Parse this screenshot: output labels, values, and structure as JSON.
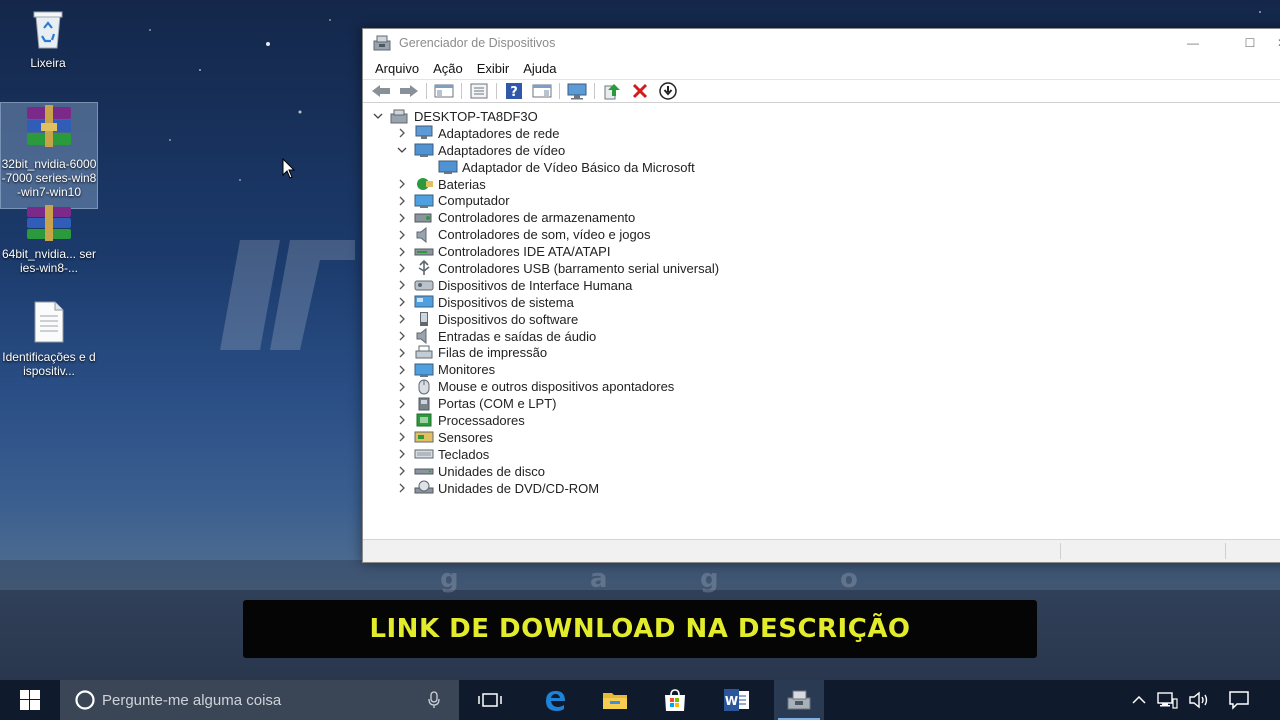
{
  "desktop": {
    "icons": [
      {
        "label": "Lixeira",
        "icon": "recycle-bin-icon"
      },
      {
        "label": "32bit_nvidia-6000-7000 series-win8-win7-win10",
        "icon": "winrar-archive-icon"
      },
      {
        "label": "64bit_nvidia... series-win8-...",
        "icon": "winrar-archive-icon"
      },
      {
        "label": "Identificações e dispositiv...",
        "icon": "text-document-icon"
      }
    ]
  },
  "window": {
    "title": "Gerenciador de Dispositivos",
    "controls": {
      "minimize": "—",
      "maximize": "☐",
      "close": "✕"
    },
    "menu": [
      "Arquivo",
      "Ação",
      "Exibir",
      "Ajuda"
    ],
    "toolbar": [
      "back-arrow-icon",
      "forward-arrow-icon",
      "show-hide-console-tree-icon",
      "properties-icon",
      "help-icon",
      "action-pane-icon",
      "monitor-scan-icon",
      "update-driver-icon",
      "uninstall-device-icon",
      "disable-device-icon"
    ],
    "tree": {
      "root": "DESKTOP-TA8DF3O",
      "categories": [
        {
          "label": "Adaptadores de rede",
          "expanded": false,
          "icon": "network-adapter-icon"
        },
        {
          "label": "Adaptadores de vídeo",
          "expanded": true,
          "icon": "display-adapter-icon",
          "children": [
            "Adaptador de Vídeo Básico da Microsoft"
          ]
        },
        {
          "label": "Baterias",
          "expanded": false,
          "icon": "battery-icon"
        },
        {
          "label": "Computador",
          "expanded": false,
          "icon": "computer-icon"
        },
        {
          "label": "Controladores de armazenamento",
          "expanded": false,
          "icon": "storage-controller-icon"
        },
        {
          "label": "Controladores de som, vídeo e jogos",
          "expanded": false,
          "icon": "speaker-icon"
        },
        {
          "label": "Controladores IDE ATA/ATAPI",
          "expanded": false,
          "icon": "ide-controller-icon"
        },
        {
          "label": "Controladores USB (barramento serial universal)",
          "expanded": false,
          "icon": "usb-icon"
        },
        {
          "label": "Dispositivos de Interface Humana",
          "expanded": false,
          "icon": "hid-icon"
        },
        {
          "label": "Dispositivos de sistema",
          "expanded": false,
          "icon": "system-device-icon"
        },
        {
          "label": "Dispositivos do software",
          "expanded": false,
          "icon": "software-device-icon"
        },
        {
          "label": "Entradas e saídas de áudio",
          "expanded": false,
          "icon": "audio-io-icon"
        },
        {
          "label": "Filas de impressão",
          "expanded": false,
          "icon": "printer-icon"
        },
        {
          "label": "Monitores",
          "expanded": false,
          "icon": "monitor-icon"
        },
        {
          "label": "Mouse e outros dispositivos apontadores",
          "expanded": false,
          "icon": "mouse-icon"
        },
        {
          "label": "Portas (COM e LPT)",
          "expanded": false,
          "icon": "port-icon"
        },
        {
          "label": "Processadores",
          "expanded": false,
          "icon": "processor-icon"
        },
        {
          "label": "Sensores",
          "expanded": false,
          "icon": "sensor-icon"
        },
        {
          "label": "Teclados",
          "expanded": false,
          "icon": "keyboard-icon"
        },
        {
          "label": "Unidades de disco",
          "expanded": false,
          "icon": "disk-drive-icon"
        },
        {
          "label": "Unidades de DVD/CD-ROM",
          "expanded": false,
          "icon": "dvd-drive-icon"
        }
      ]
    }
  },
  "banner": {
    "text": "LINK DE DOWNLOAD NA DESCRIÇÃO"
  },
  "taskbar": {
    "search_placeholder": "Pergunte-me alguma coisa",
    "apps": [
      "task-view-icon",
      "edge-icon",
      "file-explorer-icon",
      "store-icon",
      "word-icon",
      "device-manager-icon"
    ],
    "active_app": "device-manager-icon",
    "tray": [
      "chevron-up-icon",
      "network-icon",
      "volume-icon",
      "action-center-icon"
    ]
  },
  "colors": {
    "banner_text": "#e3ec2b",
    "taskbar": "#0f1a2c",
    "search": "#3a4556"
  }
}
